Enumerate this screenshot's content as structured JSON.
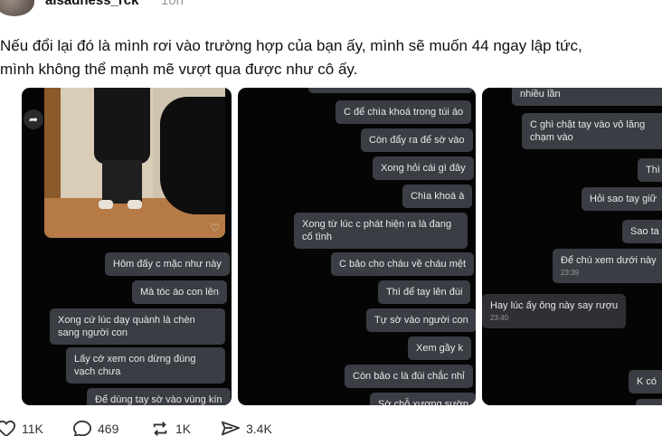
{
  "post": {
    "username": "aisadness_rck",
    "time_ago": "10h",
    "text_lines": [
      "Nếu đổi lại đó là mình rơi vào trường hợp của bạn ấy, mình sẽ muốn 44 ngay lập tức,",
      "mình không thể mạnh mẽ vượt qua được như cô ấy."
    ]
  },
  "carousel": {
    "card1": {
      "messages": [
        "Hôm đấy c mặc như này",
        "Mà tóc áo con lên",
        "Xong cứ lúc dạy quành là chèn sang người con",
        "Lấy cớ xem con dừng đúng vạch chưa",
        "Để dùng tay sờ vào vùng kín"
      ]
    },
    "card2": {
      "messages": [
        "C để chìa khoá trong túi áo",
        "Còn đẩy ra để sờ vào",
        "Xong hỏi cái gì đây",
        "Chìa khoá à",
        "Xong từ lúc c phát hiện ra là đang cố tình",
        "C bảo cho cháu về cháu mệt",
        "Thì để tay lên đùi",
        "Tự sờ vào người con",
        "Xem gầy k",
        "Còn bảo c là đùi chắc nhỉ",
        "Sờ chỗ xương sườn"
      ]
    },
    "card3": {
      "messages": [
        "nhiều lần",
        "C ghì chặt tay vào vô lăng chạm vào",
        "Thì",
        "Hỏi sao tay giữ",
        "Sao ta",
        "Để chú xem dưới này",
        "Hay lúc ấy ông này say rượu",
        "K có"
      ],
      "timestamps": [
        "23:39",
        "23:40"
      ]
    }
  },
  "actions": {
    "likes": "11K",
    "comments": "469",
    "reposts": "1K",
    "shares": "3.4K"
  }
}
